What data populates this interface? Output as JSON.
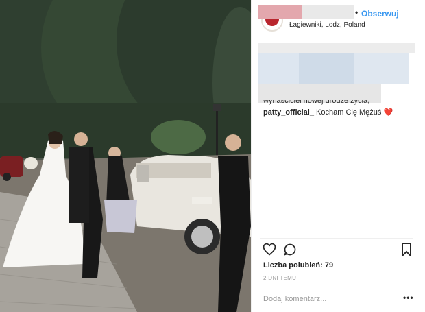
{
  "post": {
    "location": "Łagiewniki, Lodz, Poland",
    "follow_label": "Obserwuj",
    "dot": "•",
    "cut_caption_line": "wyńaściciel nowej drodze życia,",
    "comment": {
      "author": "patty_official_",
      "text": "Kocham Cię Mężuś",
      "emoji": "❤️"
    },
    "likes_text": "Liczba polubień: 79",
    "timestamp": "2 DNI TEMU",
    "comment_placeholder": "Dodaj komentarz...",
    "more_label": "•••"
  },
  "colors": {
    "link": "#3897f0",
    "redaction_pink": "#e3a7ad",
    "redaction_gray": "#e9e9e9",
    "muted": "#999999"
  },
  "icons": [
    "heart-icon",
    "comment-icon",
    "bookmark-icon",
    "avatar-logo"
  ]
}
